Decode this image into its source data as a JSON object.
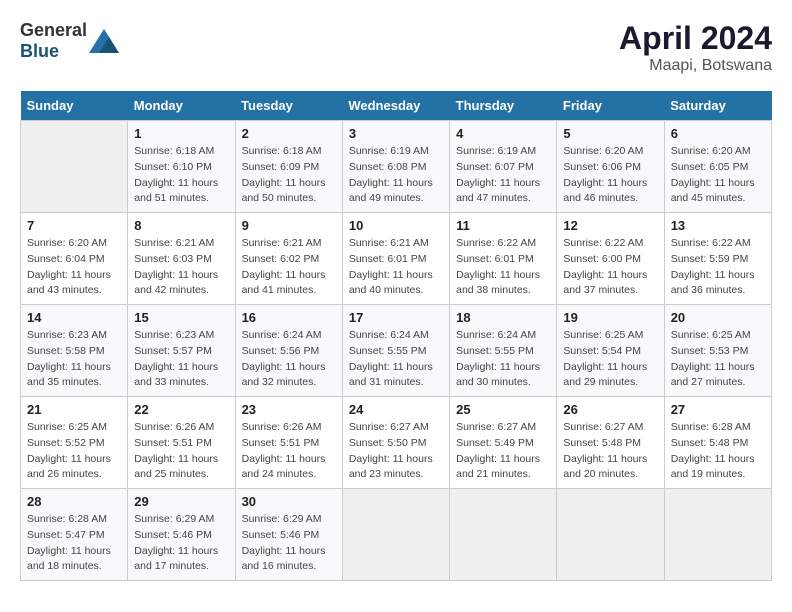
{
  "header": {
    "logo_general": "General",
    "logo_blue": "Blue",
    "title": "April 2024",
    "subtitle": "Maapi, Botswana"
  },
  "days_of_week": [
    "Sunday",
    "Monday",
    "Tuesday",
    "Wednesday",
    "Thursday",
    "Friday",
    "Saturday"
  ],
  "weeks": [
    [
      {
        "day": "",
        "sunrise": "",
        "sunset": "",
        "daylight": ""
      },
      {
        "day": "1",
        "sunrise": "Sunrise: 6:18 AM",
        "sunset": "Sunset: 6:10 PM",
        "daylight": "Daylight: 11 hours and 51 minutes."
      },
      {
        "day": "2",
        "sunrise": "Sunrise: 6:18 AM",
        "sunset": "Sunset: 6:09 PM",
        "daylight": "Daylight: 11 hours and 50 minutes."
      },
      {
        "day": "3",
        "sunrise": "Sunrise: 6:19 AM",
        "sunset": "Sunset: 6:08 PM",
        "daylight": "Daylight: 11 hours and 49 minutes."
      },
      {
        "day": "4",
        "sunrise": "Sunrise: 6:19 AM",
        "sunset": "Sunset: 6:07 PM",
        "daylight": "Daylight: 11 hours and 47 minutes."
      },
      {
        "day": "5",
        "sunrise": "Sunrise: 6:20 AM",
        "sunset": "Sunset: 6:06 PM",
        "daylight": "Daylight: 11 hours and 46 minutes."
      },
      {
        "day": "6",
        "sunrise": "Sunrise: 6:20 AM",
        "sunset": "Sunset: 6:05 PM",
        "daylight": "Daylight: 11 hours and 45 minutes."
      }
    ],
    [
      {
        "day": "7",
        "sunrise": "Sunrise: 6:20 AM",
        "sunset": "Sunset: 6:04 PM",
        "daylight": "Daylight: 11 hours and 43 minutes."
      },
      {
        "day": "8",
        "sunrise": "Sunrise: 6:21 AM",
        "sunset": "Sunset: 6:03 PM",
        "daylight": "Daylight: 11 hours and 42 minutes."
      },
      {
        "day": "9",
        "sunrise": "Sunrise: 6:21 AM",
        "sunset": "Sunset: 6:02 PM",
        "daylight": "Daylight: 11 hours and 41 minutes."
      },
      {
        "day": "10",
        "sunrise": "Sunrise: 6:21 AM",
        "sunset": "Sunset: 6:01 PM",
        "daylight": "Daylight: 11 hours and 40 minutes."
      },
      {
        "day": "11",
        "sunrise": "Sunrise: 6:22 AM",
        "sunset": "Sunset: 6:01 PM",
        "daylight": "Daylight: 11 hours and 38 minutes."
      },
      {
        "day": "12",
        "sunrise": "Sunrise: 6:22 AM",
        "sunset": "Sunset: 6:00 PM",
        "daylight": "Daylight: 11 hours and 37 minutes."
      },
      {
        "day": "13",
        "sunrise": "Sunrise: 6:22 AM",
        "sunset": "Sunset: 5:59 PM",
        "daylight": "Daylight: 11 hours and 36 minutes."
      }
    ],
    [
      {
        "day": "14",
        "sunrise": "Sunrise: 6:23 AM",
        "sunset": "Sunset: 5:58 PM",
        "daylight": "Daylight: 11 hours and 35 minutes."
      },
      {
        "day": "15",
        "sunrise": "Sunrise: 6:23 AM",
        "sunset": "Sunset: 5:57 PM",
        "daylight": "Daylight: 11 hours and 33 minutes."
      },
      {
        "day": "16",
        "sunrise": "Sunrise: 6:24 AM",
        "sunset": "Sunset: 5:56 PM",
        "daylight": "Daylight: 11 hours and 32 minutes."
      },
      {
        "day": "17",
        "sunrise": "Sunrise: 6:24 AM",
        "sunset": "Sunset: 5:55 PM",
        "daylight": "Daylight: 11 hours and 31 minutes."
      },
      {
        "day": "18",
        "sunrise": "Sunrise: 6:24 AM",
        "sunset": "Sunset: 5:55 PM",
        "daylight": "Daylight: 11 hours and 30 minutes."
      },
      {
        "day": "19",
        "sunrise": "Sunrise: 6:25 AM",
        "sunset": "Sunset: 5:54 PM",
        "daylight": "Daylight: 11 hours and 29 minutes."
      },
      {
        "day": "20",
        "sunrise": "Sunrise: 6:25 AM",
        "sunset": "Sunset: 5:53 PM",
        "daylight": "Daylight: 11 hours and 27 minutes."
      }
    ],
    [
      {
        "day": "21",
        "sunrise": "Sunrise: 6:25 AM",
        "sunset": "Sunset: 5:52 PM",
        "daylight": "Daylight: 11 hours and 26 minutes."
      },
      {
        "day": "22",
        "sunrise": "Sunrise: 6:26 AM",
        "sunset": "Sunset: 5:51 PM",
        "daylight": "Daylight: 11 hours and 25 minutes."
      },
      {
        "day": "23",
        "sunrise": "Sunrise: 6:26 AM",
        "sunset": "Sunset: 5:51 PM",
        "daylight": "Daylight: 11 hours and 24 minutes."
      },
      {
        "day": "24",
        "sunrise": "Sunrise: 6:27 AM",
        "sunset": "Sunset: 5:50 PM",
        "daylight": "Daylight: 11 hours and 23 minutes."
      },
      {
        "day": "25",
        "sunrise": "Sunrise: 6:27 AM",
        "sunset": "Sunset: 5:49 PM",
        "daylight": "Daylight: 11 hours and 21 minutes."
      },
      {
        "day": "26",
        "sunrise": "Sunrise: 6:27 AM",
        "sunset": "Sunset: 5:48 PM",
        "daylight": "Daylight: 11 hours and 20 minutes."
      },
      {
        "day": "27",
        "sunrise": "Sunrise: 6:28 AM",
        "sunset": "Sunset: 5:48 PM",
        "daylight": "Daylight: 11 hours and 19 minutes."
      }
    ],
    [
      {
        "day": "28",
        "sunrise": "Sunrise: 6:28 AM",
        "sunset": "Sunset: 5:47 PM",
        "daylight": "Daylight: 11 hours and 18 minutes."
      },
      {
        "day": "29",
        "sunrise": "Sunrise: 6:29 AM",
        "sunset": "Sunset: 5:46 PM",
        "daylight": "Daylight: 11 hours and 17 minutes."
      },
      {
        "day": "30",
        "sunrise": "Sunrise: 6:29 AM",
        "sunset": "Sunset: 5:46 PM",
        "daylight": "Daylight: 11 hours and 16 minutes."
      },
      {
        "day": "",
        "sunrise": "",
        "sunset": "",
        "daylight": ""
      },
      {
        "day": "",
        "sunrise": "",
        "sunset": "",
        "daylight": ""
      },
      {
        "day": "",
        "sunrise": "",
        "sunset": "",
        "daylight": ""
      },
      {
        "day": "",
        "sunrise": "",
        "sunset": "",
        "daylight": ""
      }
    ]
  ]
}
